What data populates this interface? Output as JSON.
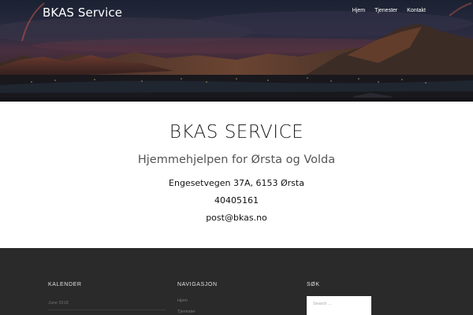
{
  "header": {
    "site_title": "BKAS Service",
    "nav": [
      {
        "label": "Hjem"
      },
      {
        "label": "Tjenester"
      },
      {
        "label": "Kontakt"
      }
    ]
  },
  "main": {
    "title": "BKAS SERVICE",
    "subtitle": "Hjemmehjelpen for Ørsta og Volda",
    "address": "Engesetvegen 37A, 6153 Ørsta",
    "phone": "40405161",
    "email": "post@bkas.no"
  },
  "footer": {
    "calendar": {
      "title": "KALENDER",
      "caption": "June 2018"
    },
    "navigation": {
      "title": "NAVIGASJON",
      "links": [
        {
          "label": "Hjem"
        },
        {
          "label": "Tjenester"
        }
      ]
    },
    "search": {
      "title": "SØK",
      "placeholder": "Search ..."
    }
  },
  "colors": {
    "footer_bg": "#2a2a2a",
    "text_dark": "#222222",
    "subtitle": "#555555"
  }
}
